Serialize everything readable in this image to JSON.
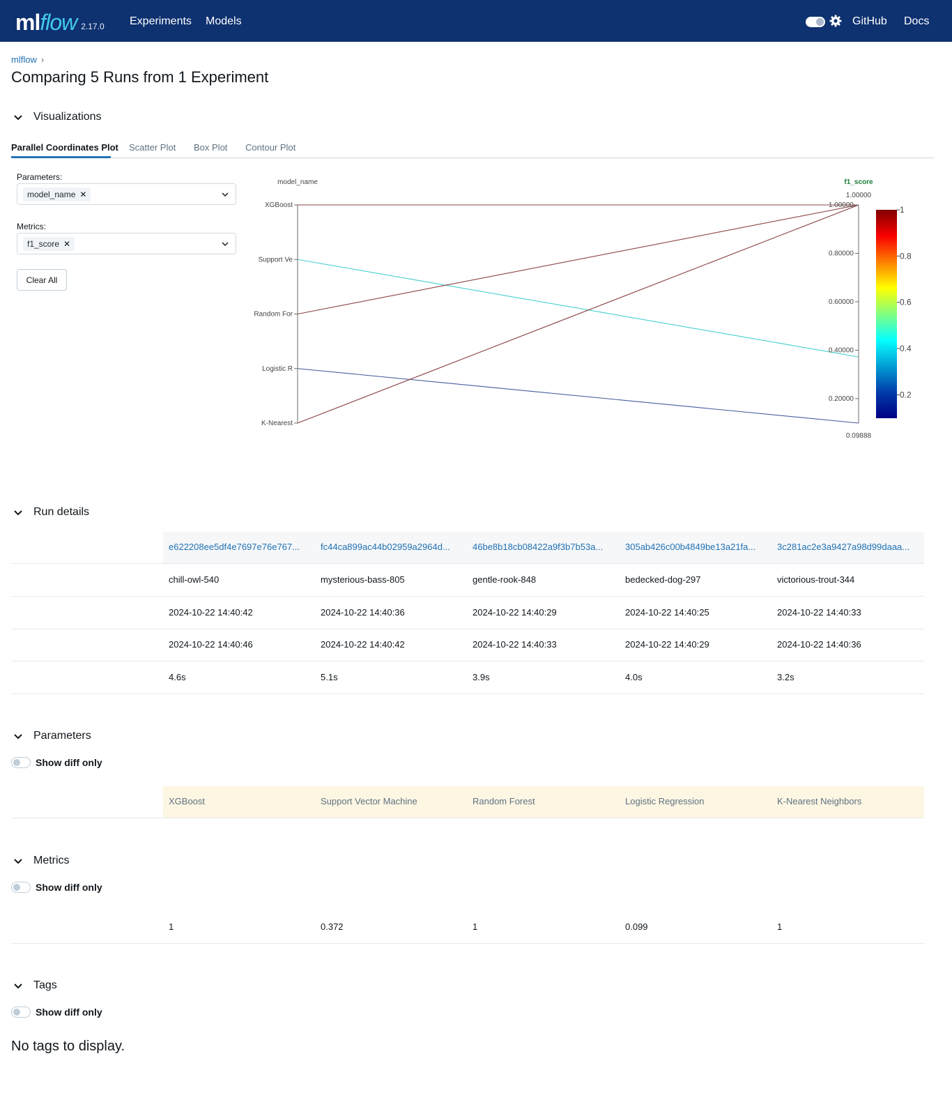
{
  "nav": {
    "logo_ml": "ml",
    "logo_flow": "flow",
    "version": "2.17.0",
    "links": [
      "Experiments",
      "Models"
    ],
    "github": "GitHub",
    "docs": "Docs",
    "brand_color": "#0e3170",
    "accent_color": "#43c9ed"
  },
  "breadcrumb": {
    "root": "mlflow",
    "separator": "›"
  },
  "page_title": "Comparing 5 Runs from 1 Experiment",
  "visualizations": {
    "heading": "Visualizations",
    "tabs": [
      "Parallel Coordinates Plot",
      "Scatter Plot",
      "Box Plot",
      "Contour Plot"
    ],
    "active_tab": "Parallel Coordinates Plot",
    "parameters_label": "Parameters:",
    "parameters_value": "model_name",
    "metrics_label": "Metrics:",
    "metrics_value": "f1_score",
    "clear_all": "Clear All"
  },
  "chart_data": {
    "type": "parallel_coordinates",
    "dimensions": [
      {
        "label": "model_name",
        "kind": "categorical",
        "ticks": [
          "XGBoost",
          "Support Ve",
          "Random For",
          "Logistic R",
          "K-Nearest"
        ]
      },
      {
        "label": "f1_score",
        "kind": "numeric",
        "range": [
          0.09888,
          1.0
        ],
        "ticks": [
          "0.20000",
          "0.40000",
          "0.60000",
          "0.80000",
          "1.00000"
        ],
        "min_label": "0.09888",
        "max_label": "1.00000"
      }
    ],
    "lines": [
      {
        "model_name": "XGBoost",
        "f1_score": 1.0
      },
      {
        "model_name": "Support Ve",
        "f1_score": 0.372
      },
      {
        "model_name": "Random For",
        "f1_score": 1.0
      },
      {
        "model_name": "Logistic R",
        "f1_score": 0.09888
      },
      {
        "model_name": "K-Nearest",
        "f1_score": 1.0
      }
    ],
    "colorbar": {
      "ticks": [
        "1",
        "0.8",
        "0.6",
        "0.4",
        "0.2"
      ],
      "colorscale": "jet"
    },
    "label_color_metric": "#1a7f37"
  },
  "run_details": {
    "heading": "Run details",
    "run_ids": [
      "e622208ee5df4e7697e76e767...",
      "fc44ca899ac44b02959a2964d...",
      "46be8b18cb08422a9f3b7b53a...",
      "305ab426c00b4849be13a21fa...",
      "3c281ac2e3a9427a98d99daaa..."
    ],
    "rows": [
      [
        "chill-owl-540",
        "mysterious-bass-805",
        "gentle-rook-848",
        "bedecked-dog-297",
        "victorious-trout-344"
      ],
      [
        "2024-10-22 14:40:42",
        "2024-10-22 14:40:36",
        "2024-10-22 14:40:29",
        "2024-10-22 14:40:25",
        "2024-10-22 14:40:33"
      ],
      [
        "2024-10-22 14:40:46",
        "2024-10-22 14:40:42",
        "2024-10-22 14:40:33",
        "2024-10-22 14:40:29",
        "2024-10-22 14:40:36"
      ],
      [
        "4.6s",
        "5.1s",
        "3.9s",
        "4.0s",
        "3.2s"
      ]
    ]
  },
  "parameters": {
    "heading": "Parameters",
    "diff_label": "Show diff only",
    "values": [
      "XGBoost",
      "Support Vector Machine",
      "Random Forest",
      "Logistic Regression",
      "K-Nearest Neighbors"
    ]
  },
  "metrics": {
    "heading": "Metrics",
    "diff_label": "Show diff only",
    "values": [
      "1",
      "0.372",
      "1",
      "0.099",
      "1"
    ]
  },
  "tags": {
    "heading": "Tags",
    "diff_label": "Show diff only",
    "empty": "No tags to display."
  }
}
